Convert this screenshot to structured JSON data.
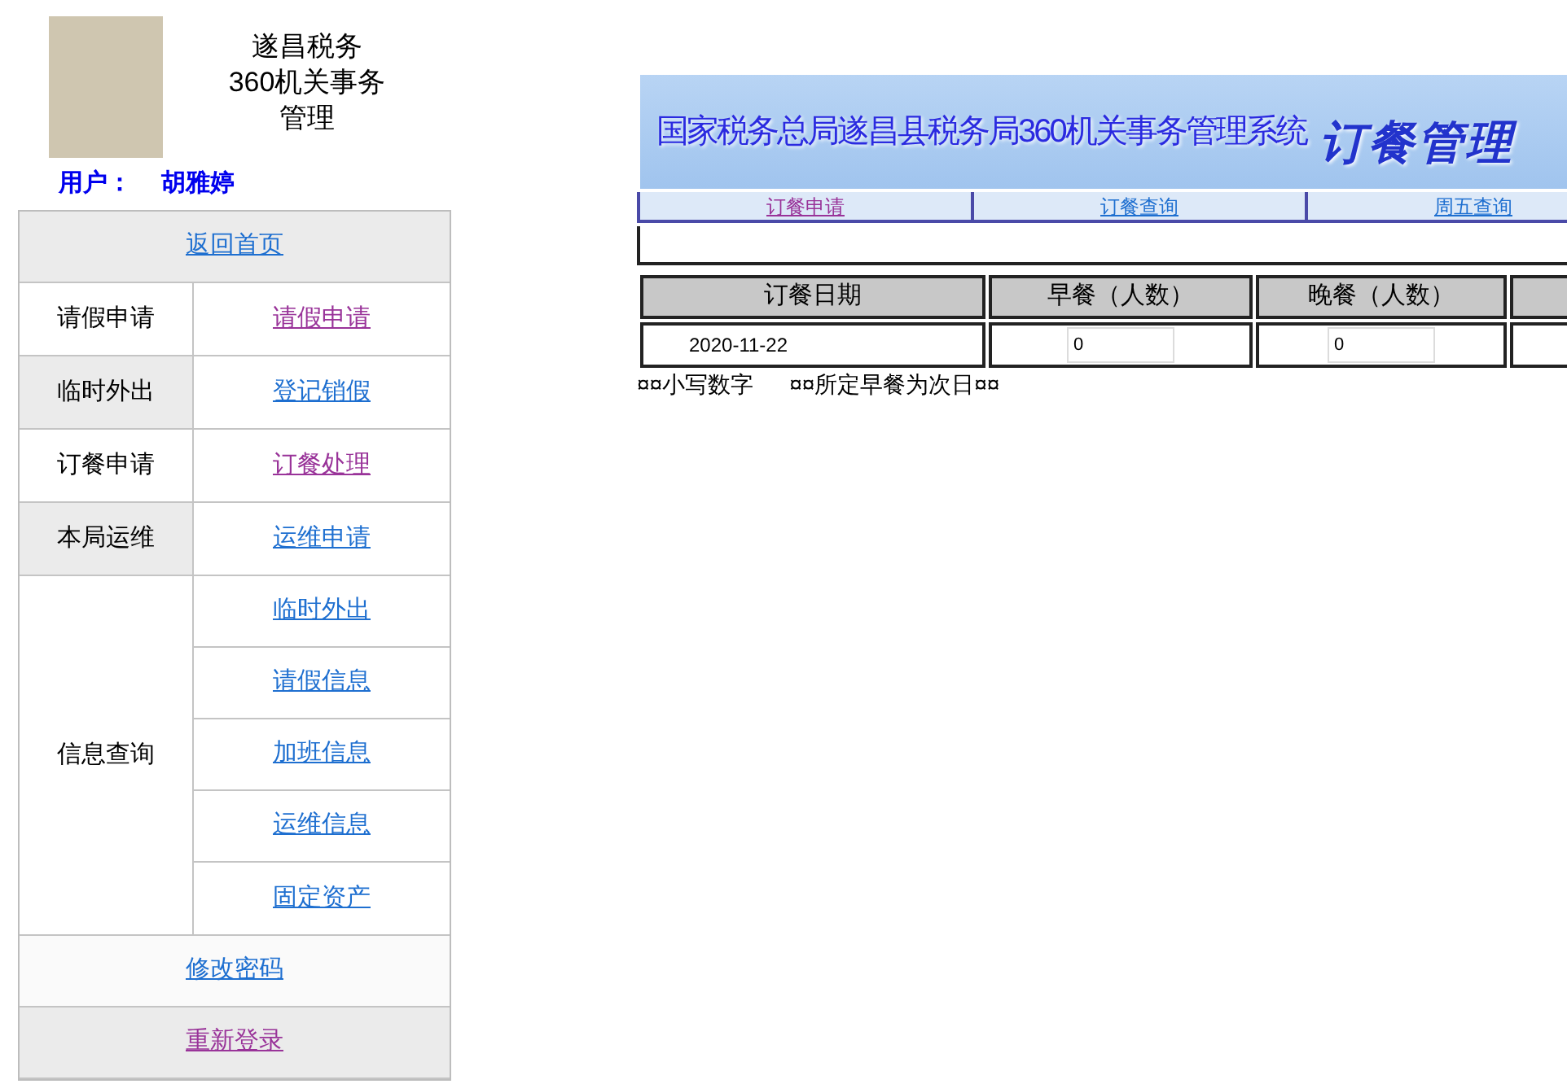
{
  "header": {
    "title_lines": [
      "遂昌税务",
      "360机关事务",
      "管理"
    ],
    "user_label": "用户：",
    "user_name": "胡雅婷"
  },
  "sidebar": {
    "top_link": {
      "label": "返回首页",
      "visited": false
    },
    "groups": [
      {
        "label": "请假申请",
        "shaded": false,
        "links": [
          {
            "label": "请假申请",
            "visited": true
          }
        ]
      },
      {
        "label": "临时外出",
        "shaded": true,
        "links": [
          {
            "label": "登记销假",
            "visited": false
          }
        ]
      },
      {
        "label": "订餐申请",
        "shaded": false,
        "links": [
          {
            "label": "订餐处理",
            "visited": true
          }
        ]
      },
      {
        "label": "本局运维",
        "shaded": true,
        "links": [
          {
            "label": "运维申请",
            "visited": false
          }
        ]
      },
      {
        "label": "信息查询",
        "shaded": false,
        "links": [
          {
            "label": "临时外出",
            "visited": false
          },
          {
            "label": "请假信息",
            "visited": false
          },
          {
            "label": "加班信息",
            "visited": false
          },
          {
            "label": "运维信息",
            "visited": false
          },
          {
            "label": "固定资产",
            "visited": false
          }
        ]
      }
    ],
    "bottom_links": [
      {
        "label": "修改密码",
        "visited": false,
        "shaded": false
      },
      {
        "label": "重新登录",
        "visited": true,
        "shaded": true
      }
    ]
  },
  "banner": {
    "title": "国家税务总局遂昌县税务局360机关事务管理系统",
    "section": "订餐管理"
  },
  "tabs": [
    {
      "label": "订餐申请",
      "visited": true
    },
    {
      "label": "订餐查询",
      "visited": false
    },
    {
      "label": "周五查询",
      "visited": false
    }
  ],
  "table": {
    "columns": [
      "订餐日期",
      "早餐（人数）",
      "晚餐（人数）"
    ],
    "rows": [
      {
        "date": "2020-11-22",
        "breakfast": "0",
        "dinner": "0"
      }
    ]
  },
  "notes": [
    "¤¤小写数字",
    "¤¤所定早餐为次日¤¤"
  ]
}
